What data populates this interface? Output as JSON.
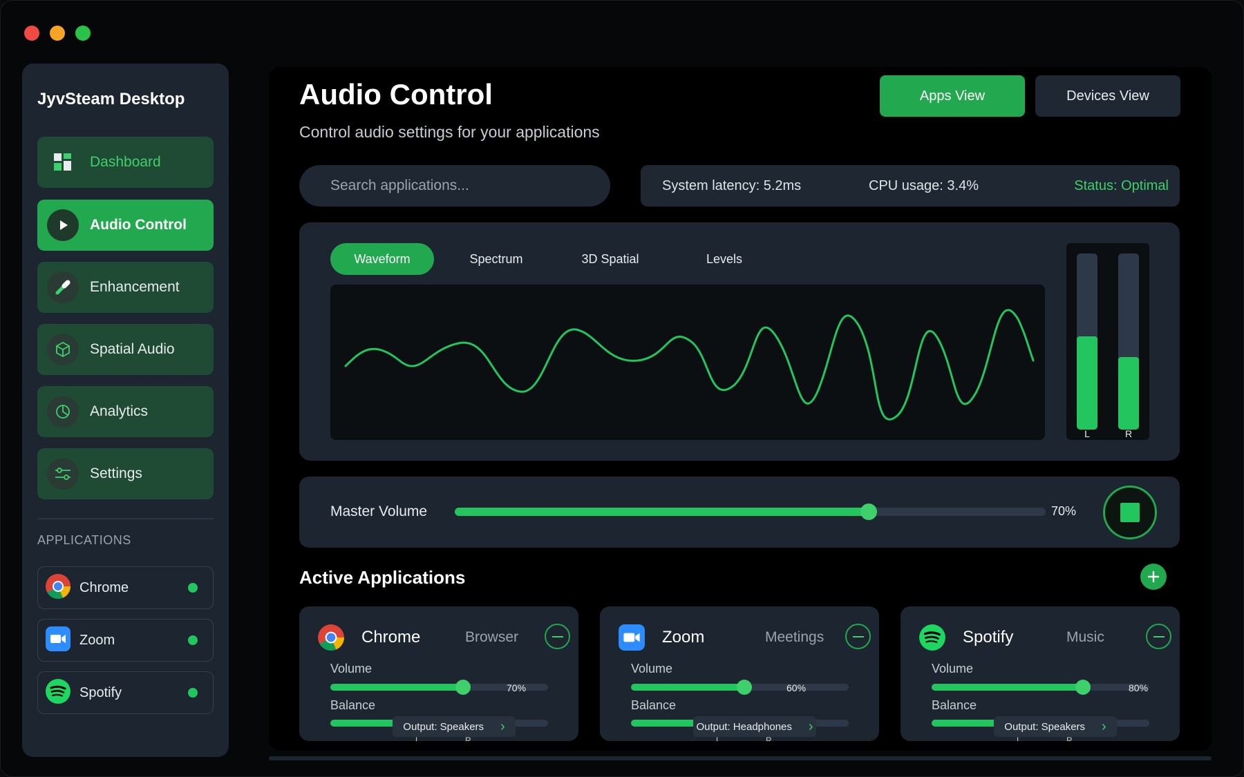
{
  "sidebar": {
    "title": "JyvSteam Desktop",
    "items": [
      {
        "label": "Dashboard",
        "icon": "dashboard-icon"
      },
      {
        "label": "Audio Control",
        "icon": "play-icon"
      },
      {
        "label": "Enhancement",
        "icon": "magic-wand-icon"
      },
      {
        "label": "Spatial Audio",
        "icon": "cube-icon"
      },
      {
        "label": "Analytics",
        "icon": "pie-chart-icon"
      },
      {
        "label": "Settings",
        "icon": "sliders-icon"
      }
    ],
    "section_label": "APPLICATIONS",
    "apps": [
      {
        "label": "Chrome",
        "icon": "chrome-icon",
        "status": "active"
      },
      {
        "label": "Zoom",
        "icon": "zoom-icon",
        "status": "active"
      },
      {
        "label": "Spotify",
        "icon": "spotify-icon",
        "status": "active"
      }
    ]
  },
  "header": {
    "title": "Audio Control",
    "subtitle": "Control audio settings for your applications",
    "apps_view": "Apps View",
    "devices_view": "Devices View"
  },
  "search": {
    "placeholder": "Search applications...",
    "value": ""
  },
  "stats": {
    "latency": "System latency: 5.2ms",
    "cpu": "CPU usage: 3.4%",
    "status": "Status: Optimal"
  },
  "visualizer": {
    "tabs": [
      "Waveform",
      "Spectrum",
      "3D Spatial",
      "Levels"
    ],
    "active_tab": "Waveform",
    "meter": {
      "left_label": "L",
      "right_label": "R",
      "left_level": 0.53,
      "right_level": 0.41
    }
  },
  "master": {
    "label": "Master Volume",
    "value": 70,
    "display": "70%"
  },
  "active_apps": {
    "title": "Active Applications",
    "volume_label": "Volume",
    "balance_label": "Balance",
    "balance_left": "L",
    "balance_right": "R",
    "cards": [
      {
        "name": "Chrome",
        "category": "Browser",
        "volume": 70,
        "volume_display": "70%",
        "output": "Output: Speakers",
        "icon": "chrome-icon"
      },
      {
        "name": "Zoom",
        "category": "Meetings",
        "volume": 60,
        "volume_display": "60%",
        "output": "Output: Headphones",
        "icon": "zoom-icon"
      },
      {
        "name": "Spotify",
        "category": "Music",
        "volume": 80,
        "volume_display": "80%",
        "output": "Output: Speakers",
        "icon": "spotify-icon"
      }
    ]
  },
  "colors": {
    "accent": "#22a84e",
    "accent_bright": "#22c55e",
    "panel": "#1d2530",
    "background": "#000000"
  }
}
